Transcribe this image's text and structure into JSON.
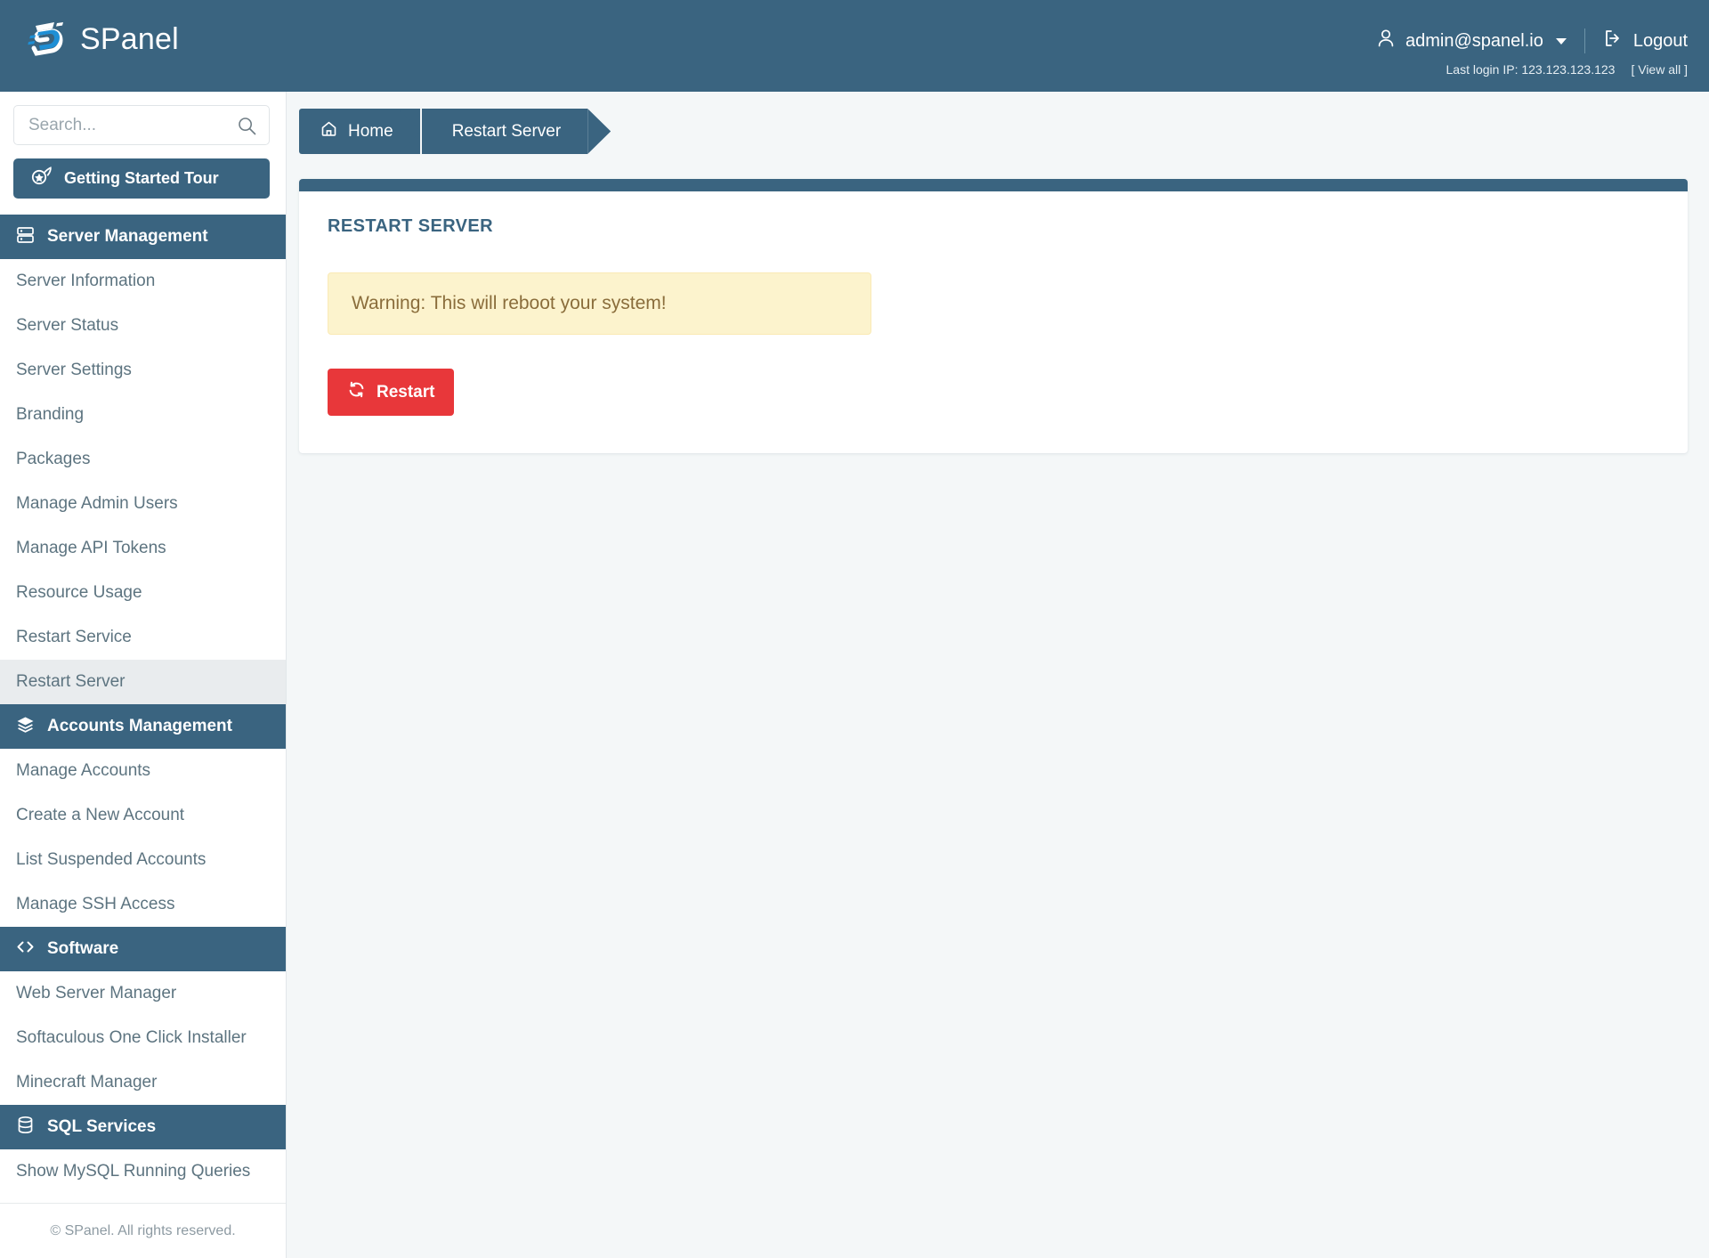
{
  "header": {
    "brand": "SPanel",
    "brand_logo_icon": "spanel-logo-icon",
    "user_icon": "user-icon",
    "user_email": "admin@spanel.io",
    "logout_icon": "logout-icon",
    "logout_label": "Logout",
    "last_login_label": "Last login IP: 123.123.123.123",
    "view_all_label": "[ View all ]"
  },
  "sidebar": {
    "search": {
      "value": "",
      "placeholder": "Search...",
      "icon": "search-icon"
    },
    "tour_button": {
      "label": "Getting Started Tour",
      "icon": "rocket-icon"
    },
    "sections": [
      {
        "label": "Server Management",
        "icon": "server-icon",
        "items": [
          {
            "label": "Server Information",
            "active": false
          },
          {
            "label": "Server Status",
            "active": false
          },
          {
            "label": "Server Settings",
            "active": false
          },
          {
            "label": "Branding",
            "active": false
          },
          {
            "label": "Packages",
            "active": false
          },
          {
            "label": "Manage Admin Users",
            "active": false
          },
          {
            "label": "Manage API Tokens",
            "active": false
          },
          {
            "label": "Resource Usage",
            "active": false
          },
          {
            "label": "Restart Service",
            "active": false
          },
          {
            "label": "Restart Server",
            "active": true
          }
        ]
      },
      {
        "label": "Accounts Management",
        "icon": "layers-icon",
        "items": [
          {
            "label": "Manage Accounts",
            "active": false
          },
          {
            "label": "Create a New Account",
            "active": false
          },
          {
            "label": "List Suspended Accounts",
            "active": false
          },
          {
            "label": "Manage SSH Access",
            "active": false
          }
        ]
      },
      {
        "label": "Software",
        "icon": "code-icon",
        "items": [
          {
            "label": "Web Server Manager",
            "active": false
          },
          {
            "label": "Softaculous One Click Installer",
            "active": false
          },
          {
            "label": "Minecraft Manager",
            "active": false
          }
        ]
      },
      {
        "label": "SQL Services",
        "icon": "database-icon",
        "items": [
          {
            "label": "Show MySQL Running Queries",
            "active": false
          }
        ]
      }
    ],
    "footer": "© SPanel. All rights reserved."
  },
  "breadcrumb": {
    "home_icon": "home-icon",
    "home_label": "Home",
    "current_label": "Restart Server"
  },
  "main": {
    "card_title": "RESTART SERVER",
    "warning_text": "Warning: This will reboot your system!",
    "restart_button": {
      "label": "Restart",
      "icon": "refresh-icon"
    }
  },
  "colors": {
    "brand_blue": "#3a6480",
    "logo_blue": "#1e8fd5",
    "page_bg": "#f4f7f8",
    "warning_bg": "#fcf3cd",
    "warning_text": "#8a6d3b",
    "danger_red": "#e8373a",
    "active_item_bg": "#e9ecee"
  }
}
